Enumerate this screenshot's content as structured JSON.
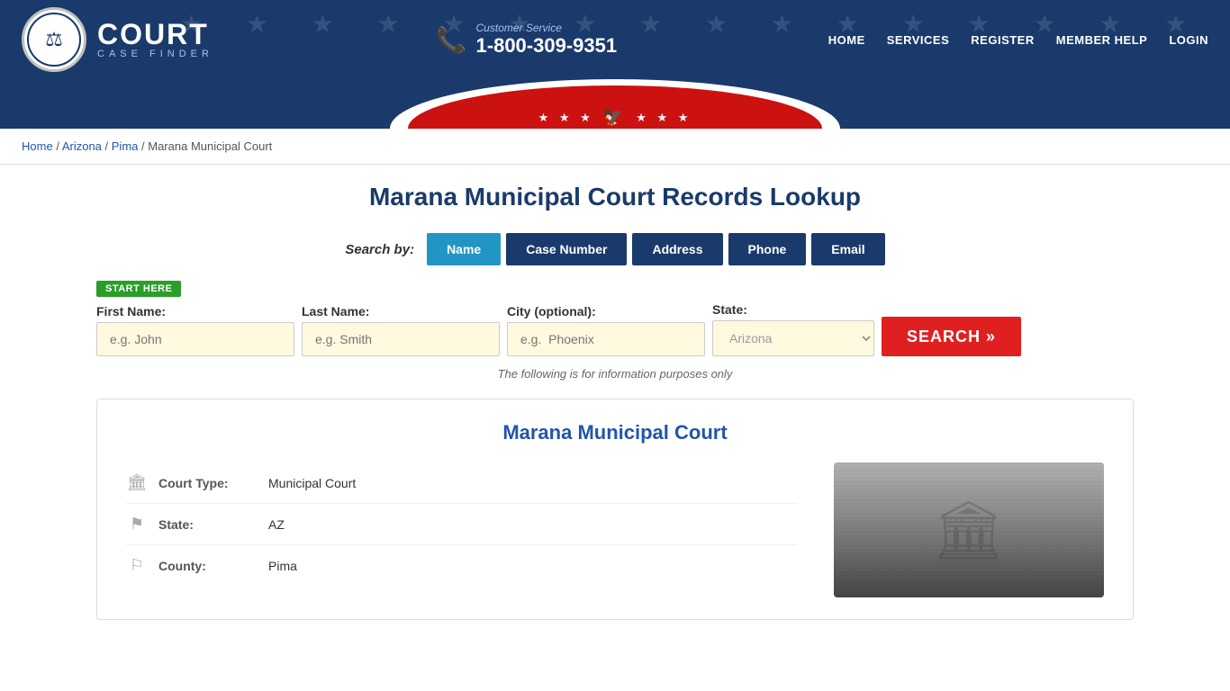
{
  "header": {
    "logo_court": "COURT",
    "logo_case_finder": "CASE FINDER",
    "customer_service_label": "Customer Service",
    "phone": "1-800-309-9351",
    "nav": {
      "home": "HOME",
      "services": "SERVICES",
      "register": "REGISTER",
      "member_help": "MEMBER HELP",
      "login": "LOGIN"
    }
  },
  "banner": {
    "stars_left": "★ ★ ★",
    "stars_right": "★ ★ ★"
  },
  "breadcrumb": {
    "home": "Home",
    "arizona": "Arizona",
    "pima": "Pima",
    "current": "Marana Municipal Court"
  },
  "main": {
    "page_title": "Marana Municipal Court Records Lookup",
    "search_by_label": "Search by:",
    "tabs": [
      {
        "label": "Name",
        "active": true
      },
      {
        "label": "Case Number",
        "active": false
      },
      {
        "label": "Address",
        "active": false
      },
      {
        "label": "Phone",
        "active": false
      },
      {
        "label": "Email",
        "active": false
      }
    ],
    "start_here_badge": "START HERE",
    "form": {
      "first_name_label": "First Name:",
      "first_name_placeholder": "e.g. John",
      "last_name_label": "Last Name:",
      "last_name_placeholder": "e.g. Smith",
      "city_label": "City (optional):",
      "city_placeholder": "e.g.  Phoenix",
      "state_label": "State:",
      "state_value": "Arizona",
      "search_button": "SEARCH »"
    },
    "info_note": "The following is for information purposes only",
    "court_card": {
      "title": "Marana Municipal Court",
      "rows": [
        {
          "icon": "building",
          "label": "Court Type:",
          "value": "Municipal Court"
        },
        {
          "icon": "flag",
          "label": "State:",
          "value": "AZ"
        },
        {
          "icon": "map-marker",
          "label": "County:",
          "value": "Pima"
        }
      ]
    }
  }
}
